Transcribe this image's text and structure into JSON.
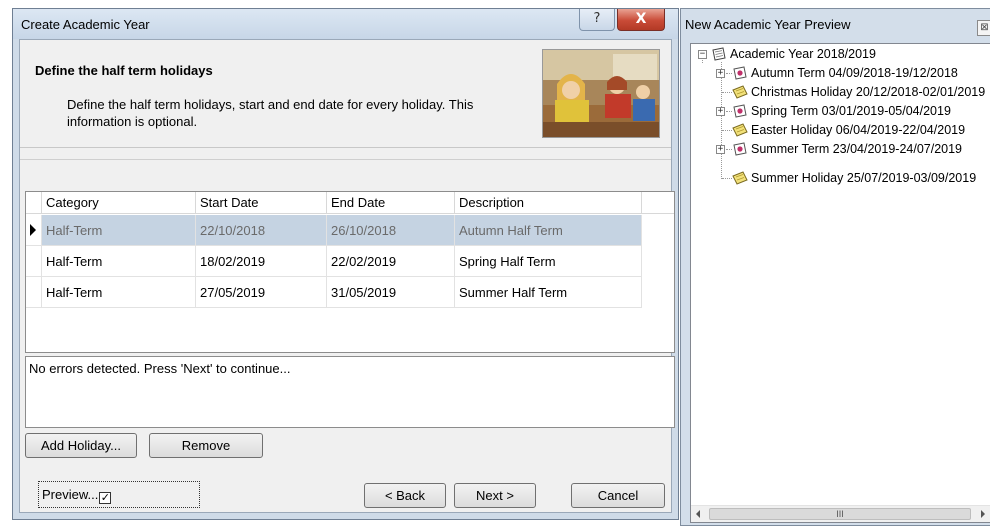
{
  "dialog": {
    "title": "Create Academic Year",
    "help_icon": "?",
    "close_icon": "X",
    "heading": "Define the half term holidays",
    "description": "Define the half term holidays, start and end date for every holiday. This information is optional.",
    "grid": {
      "columns": [
        "Category",
        "Start Date",
        "End Date",
        "Description"
      ],
      "rows": [
        {
          "category": "Half-Term",
          "start": "22/10/2018",
          "end": "26/10/2018",
          "description": "Autumn Half Term",
          "selected": true
        },
        {
          "category": "Half-Term",
          "start": "18/02/2019",
          "end": "22/02/2019",
          "description": "Spring Half Term"
        },
        {
          "category": "Half-Term",
          "start": "27/05/2019",
          "end": "31/05/2019",
          "description": "Summer Half Term"
        }
      ]
    },
    "message": "No errors detected. Press 'Next' to continue...",
    "add_holiday_label": "Add Holiday...",
    "remove_label": "Remove",
    "preview_label": "Preview...",
    "preview_checked_glyph": "✓",
    "back_label": "< Back",
    "next_label": "Next >",
    "cancel_label": "Cancel"
  },
  "preview_panel": {
    "title": "New Academic Year Preview",
    "close_icon": "⊠",
    "tree": {
      "root": {
        "label": "Academic Year 2018/2019",
        "expander": "−"
      },
      "children": [
        {
          "label": "Autumn Term 04/09/2018-19/12/2018",
          "icon": "term-icon",
          "expander": "+"
        },
        {
          "label": "Christmas Holiday 20/12/2018-02/01/2019",
          "icon": "holiday-icon"
        },
        {
          "label": "Spring Term 03/01/2019-05/04/2019",
          "icon": "term-icon",
          "expander": "+"
        },
        {
          "label": "Easter Holiday 06/04/2019-22/04/2019",
          "icon": "holiday-icon"
        },
        {
          "label": "Summer Term 23/04/2019-24/07/2019",
          "icon": "term-icon",
          "expander": "+"
        },
        {
          "label": "Summer Holiday 25/07/2019-03/09/2019",
          "icon": "holiday-icon"
        }
      ]
    },
    "scrollbar_grip": "III"
  },
  "colors": {
    "title_bar": "#c7d6e7",
    "selected_row": "#c5d3e2",
    "close_button": "#c94b37"
  }
}
